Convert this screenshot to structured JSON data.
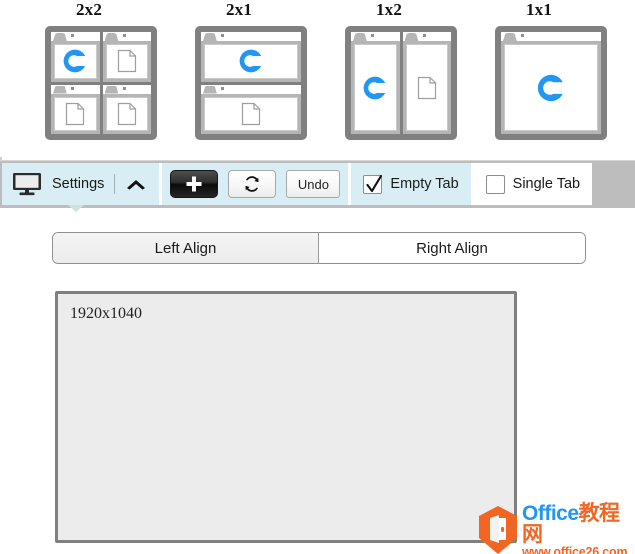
{
  "layouts": [
    {
      "label": "2x2",
      "grid": "g2x2",
      "icon_name": "layout-2x2-icon",
      "panes": [
        "chrome",
        "doc",
        "doc",
        "doc"
      ]
    },
    {
      "label": "2x1",
      "grid": "g2x1",
      "icon_name": "layout-2x1-icon",
      "panes": [
        "chrome",
        "doc"
      ]
    },
    {
      "label": "1x2",
      "grid": "g1x2",
      "icon_name": "layout-1x2-icon",
      "panes": [
        "chrome",
        "doc"
      ]
    },
    {
      "label": "1x1",
      "grid": "g1x1",
      "icon_name": "layout-1x1-icon",
      "panes": [
        "chrome"
      ]
    }
  ],
  "toolbar": {
    "settings": {
      "label": "Settings",
      "monitor_icon": "monitor-icon",
      "chevron_icon": "chevron-up-icon",
      "expanded": true
    },
    "actions": {
      "add_label": "+",
      "add_icon": "plus-icon",
      "refresh_icon": "refresh-icon",
      "undo_label": "Undo"
    },
    "checkboxes": [
      {
        "label": "Empty Tab",
        "checked": true,
        "check_icon": "checkmark-icon"
      },
      {
        "label": "Single Tab",
        "checked": false,
        "check_icon": ""
      }
    ]
  },
  "align": {
    "options": [
      {
        "label": "Left Align",
        "selected": true
      },
      {
        "label": "Right Align",
        "selected": false
      }
    ]
  },
  "editor": {
    "value": "1920x1040",
    "placeholder": ""
  },
  "watermark": {
    "title_en": "Office",
    "title_cn": "教程网",
    "url": "www.office26.com",
    "badge_icon": "office-badge-icon"
  },
  "colors": {
    "accent_blue": "#0b5c92",
    "toolbar_bg": "#d9eef4",
    "toolbar_chrome": "#bdbdbd",
    "frame_gray": "#808080",
    "chrome_logo_blue": "#2196f3",
    "watermark_orange": "#f26522",
    "watermark_blue": "#2196f3",
    "textarea_bg": "#ececec"
  }
}
